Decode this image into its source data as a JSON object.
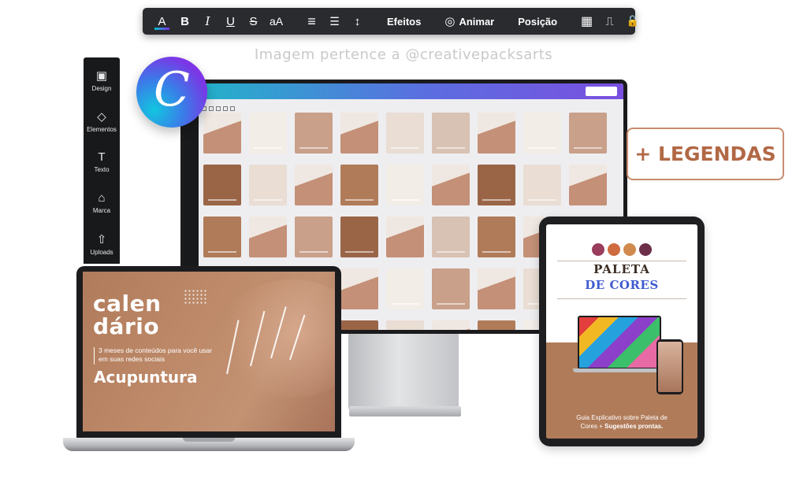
{
  "toolbar": {
    "items": [
      {
        "name": "font-color-icon",
        "glyph": "A"
      },
      {
        "name": "bold-icon",
        "glyph": "B"
      },
      {
        "name": "italic-icon",
        "glyph": "I"
      },
      {
        "name": "underline-icon",
        "glyph": "U"
      },
      {
        "name": "strikethrough-icon",
        "glyph": "S"
      },
      {
        "name": "text-case-icon",
        "glyph": "aA"
      }
    ],
    "align_glyph": "≡",
    "list_glyph": "☰",
    "spacing_glyph": "↕",
    "effects_label": "Efeitos",
    "animate_label": "Animar",
    "animate_glyph": "◎",
    "position_label": "Posição",
    "transparency_glyph": "▦",
    "paint_glyph": "⎍",
    "lock_glyph": "🔓"
  },
  "watermark": "Imagem pertence a @creativepacksarts",
  "side_panel": {
    "items": [
      {
        "label": "Design",
        "icon": "design-icon",
        "glyph": "▣"
      },
      {
        "label": "Elementos",
        "icon": "elements-icon",
        "glyph": "◇"
      },
      {
        "label": "Texto",
        "icon": "text-icon",
        "glyph": "T"
      },
      {
        "label": "Marca",
        "icon": "brand-icon",
        "glyph": "⌂"
      },
      {
        "label": "Uploads",
        "icon": "upload-icon",
        "glyph": "⇧"
      }
    ]
  },
  "logo": {
    "letter": "C"
  },
  "legendas": "+ LEGENDAS",
  "laptop": {
    "title_line1": "calen",
    "title_line2": "dário",
    "subtitle": "3 meses de conteúdos para você usar em suas redes sociais",
    "specialty": "Acupuntura"
  },
  "tablet": {
    "colors": [
      "#9a3d5c",
      "#cf6b3f",
      "#d08a4e",
      "#6c2f47"
    ],
    "title_line1": "PALETA",
    "title_line2": "DE CORES",
    "caption_line1": "Guia Explicativo sobre Paleta de",
    "caption_line2_prefix": "Cores + ",
    "caption_line2_bold": "Sugestões prontas."
  },
  "colors": {
    "brand_brown": "#b07b59",
    "accent_text": "#b26845",
    "toolbar_bg": "#2a2b2f"
  }
}
